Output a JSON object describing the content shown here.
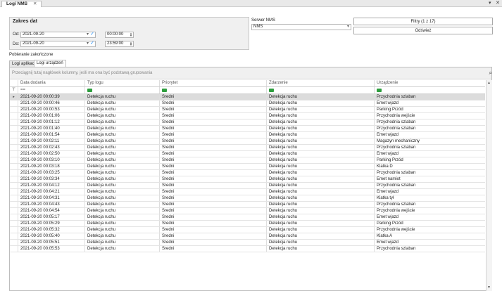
{
  "window": {
    "tab_title": "Logi NMS",
    "close_glyph": "✕",
    "pin_glyph": "▾",
    "winclose_glyph": "✕"
  },
  "date_range": {
    "title": "Zakres dat",
    "from_label": "Od:",
    "from_date": "2021-09-20",
    "from_time": "00:00:00",
    "to_label": "Do:",
    "to_date": "2021-09-20",
    "to_time": "23:59:00"
  },
  "server": {
    "label": "Serwer NMS",
    "value": "NMS"
  },
  "buttons": {
    "filters": "Filtry (1 z 17)",
    "refresh": "Odśwież"
  },
  "status": "Pobieranie zakończone",
  "tabs": [
    {
      "label": "Logi aplikacji"
    },
    {
      "label": "Logi urządzeń"
    }
  ],
  "grid": {
    "group_hint": "Przeciągnij tutaj nagłówek kolumny, jeśli ma ona być podstawą grupowania",
    "columns": [
      "Data dodania",
      "Typ logu",
      "Priorytet",
      "Zdarzenie",
      "Urządzenie"
    ],
    "filter_text": "==",
    "rows": [
      [
        "2021-09-20 00:00:39",
        "Detekcja ruchu",
        "Średni",
        "Detekcja ruchu",
        "Przychodnia szlaban"
      ],
      [
        "2021-09-20 00:00:46",
        "Detekcja ruchu",
        "Średni",
        "Detekcja ruchu",
        "Emet wjazd"
      ],
      [
        "2021-09-20 00:00:53",
        "Detekcja ruchu",
        "Średni",
        "Detekcja ruchu",
        "Parking Przód"
      ],
      [
        "2021-09-20 00:01:06",
        "Detekcja ruchu",
        "Średni",
        "Detekcja ruchu",
        "Przychodnia wejście"
      ],
      [
        "2021-09-20 00:01:12",
        "Detekcja ruchu",
        "Średni",
        "Detekcja ruchu",
        "Przychodnia szlaban"
      ],
      [
        "2021-09-20 00:01:40",
        "Detekcja ruchu",
        "Średni",
        "Detekcja ruchu",
        "Przychodnia szlaban"
      ],
      [
        "2021-09-20 00:01:54",
        "Detekcja ruchu",
        "Średni",
        "Detekcja ruchu",
        "Emet wjazd"
      ],
      [
        "2021-09-20 00:02:11",
        "Detekcja ruchu",
        "Średni",
        "Detekcja ruchu",
        "Magazyn mechaniczny"
      ],
      [
        "2021-09-20 00:02:43",
        "Detekcja ruchu",
        "Średni",
        "Detekcja ruchu",
        "Przychodnia szlaban"
      ],
      [
        "2021-09-20 00:02:50",
        "Detekcja ruchu",
        "Średni",
        "Detekcja ruchu",
        "Emet wjazd"
      ],
      [
        "2021-09-20 00:03:10",
        "Detekcja ruchu",
        "Średni",
        "Detekcja ruchu",
        "Parking Przód"
      ],
      [
        "2021-09-20 00:03:18",
        "Detekcja ruchu",
        "Średni",
        "Detekcja ruchu",
        "Klatka D"
      ],
      [
        "2021-09-20 00:03:25",
        "Detekcja ruchu",
        "Średni",
        "Detekcja ruchu",
        "Przychodnia szlaban"
      ],
      [
        "2021-09-20 00:03:34",
        "Detekcja ruchu",
        "Średni",
        "Detekcja ruchu",
        "Emet namiot"
      ],
      [
        "2021-09-20 00:04:12",
        "Detekcja ruchu",
        "Średni",
        "Detekcja ruchu",
        "Przychodnia szlaban"
      ],
      [
        "2021-09-20 00:04:21",
        "Detekcja ruchu",
        "Średni",
        "Detekcja ruchu",
        "Emet wjazd"
      ],
      [
        "2021-09-20 00:04:31",
        "Detekcja ruchu",
        "Średni",
        "Detekcja ruchu",
        "Klatka tył"
      ],
      [
        "2021-09-20 00:04:43",
        "Detekcja ruchu",
        "Średni",
        "Detekcja ruchu",
        "Przychodnia szlaban"
      ],
      [
        "2021-09-20 00:04:54",
        "Detekcja ruchu",
        "Średni",
        "Detekcja ruchu",
        "Przychodnia wejście"
      ],
      [
        "2021-09-20 00:05:17",
        "Detekcja ruchu",
        "Średni",
        "Detekcja ruchu",
        "Emet wjazd"
      ],
      [
        "2021-09-20 00:05:29",
        "Detekcja ruchu",
        "Średni",
        "Detekcja ruchu",
        "Parking Przód"
      ],
      [
        "2021-09-20 00:05:32",
        "Detekcja ruchu",
        "Średni",
        "Detekcja ruchu",
        "Przychodnia wejście"
      ],
      [
        "2021-09-20 00:05:40",
        "Detekcja ruchu",
        "Średni",
        "Detekcja ruchu",
        "Klatka A"
      ],
      [
        "2021-09-20 00:05:51",
        "Detekcja ruchu",
        "Średni",
        "Detekcja ruchu",
        "Emet wjazd"
      ],
      [
        "2021-09-20 00:05:53",
        "Detekcja ruchu",
        "Średni",
        "Detekcja ruchu",
        "Przychodnia szlaban"
      ]
    ]
  }
}
